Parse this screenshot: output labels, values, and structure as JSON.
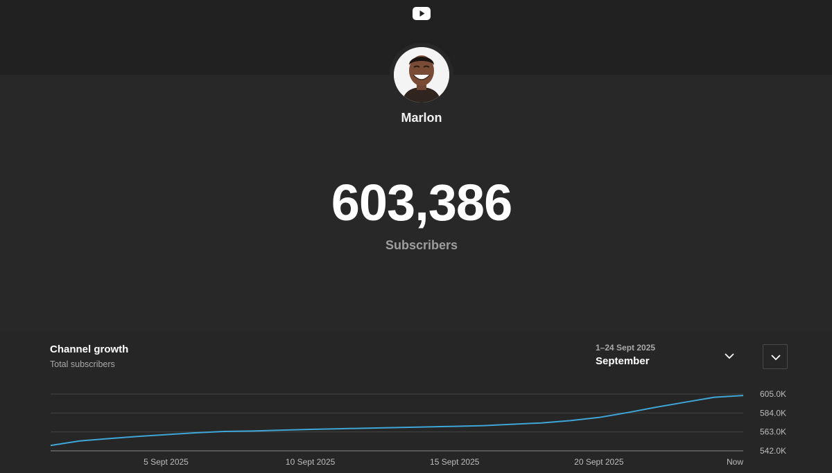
{
  "header": {
    "logo_icon": "youtube-play-icon"
  },
  "channel": {
    "name": "Marlon",
    "subscriber_count": "603,386",
    "subscriber_label": "Subscribers"
  },
  "growth": {
    "title": "Channel growth",
    "subtitle": "Total subscribers",
    "range_dates": "1–24 Sept 2025",
    "range_month": "September"
  },
  "colors": {
    "background": "#282828",
    "topbar": "#212121",
    "line": "#3ea6d8",
    "grid": "#444444"
  },
  "chart_data": {
    "type": "line",
    "title": "",
    "xlabel": "",
    "ylabel": "",
    "x_tick_labels": [
      "5 Sept 2025",
      "10 Sept 2025",
      "15 Sept 2025",
      "20 Sept 2025",
      "Now"
    ],
    "y_tick_labels": [
      "605.0K",
      "584.0K",
      "563.0K",
      "542.0K"
    ],
    "y_ticks": [
      605000,
      584000,
      563000,
      542000
    ],
    "ylim": [
      542000,
      605000
    ],
    "xlim": [
      1,
      25
    ],
    "grid": true,
    "y_axis_side": "right",
    "series": [
      {
        "color": "#3ea6d8",
        "x": [
          1,
          2,
          3,
          4,
          5,
          6,
          7,
          8,
          9,
          10,
          11,
          12,
          13,
          14,
          15,
          16,
          17,
          18,
          19,
          20,
          21,
          22,
          23,
          24,
          25
        ],
        "values": [
          548000,
          553000,
          555500,
          558000,
          560000,
          562000,
          563500,
          564000,
          565000,
          565800,
          566500,
          567200,
          567800,
          568500,
          569200,
          570000,
          571500,
          573000,
          575500,
          579000,
          584500,
          590500,
          596000,
          601500,
          603400
        ]
      }
    ]
  }
}
